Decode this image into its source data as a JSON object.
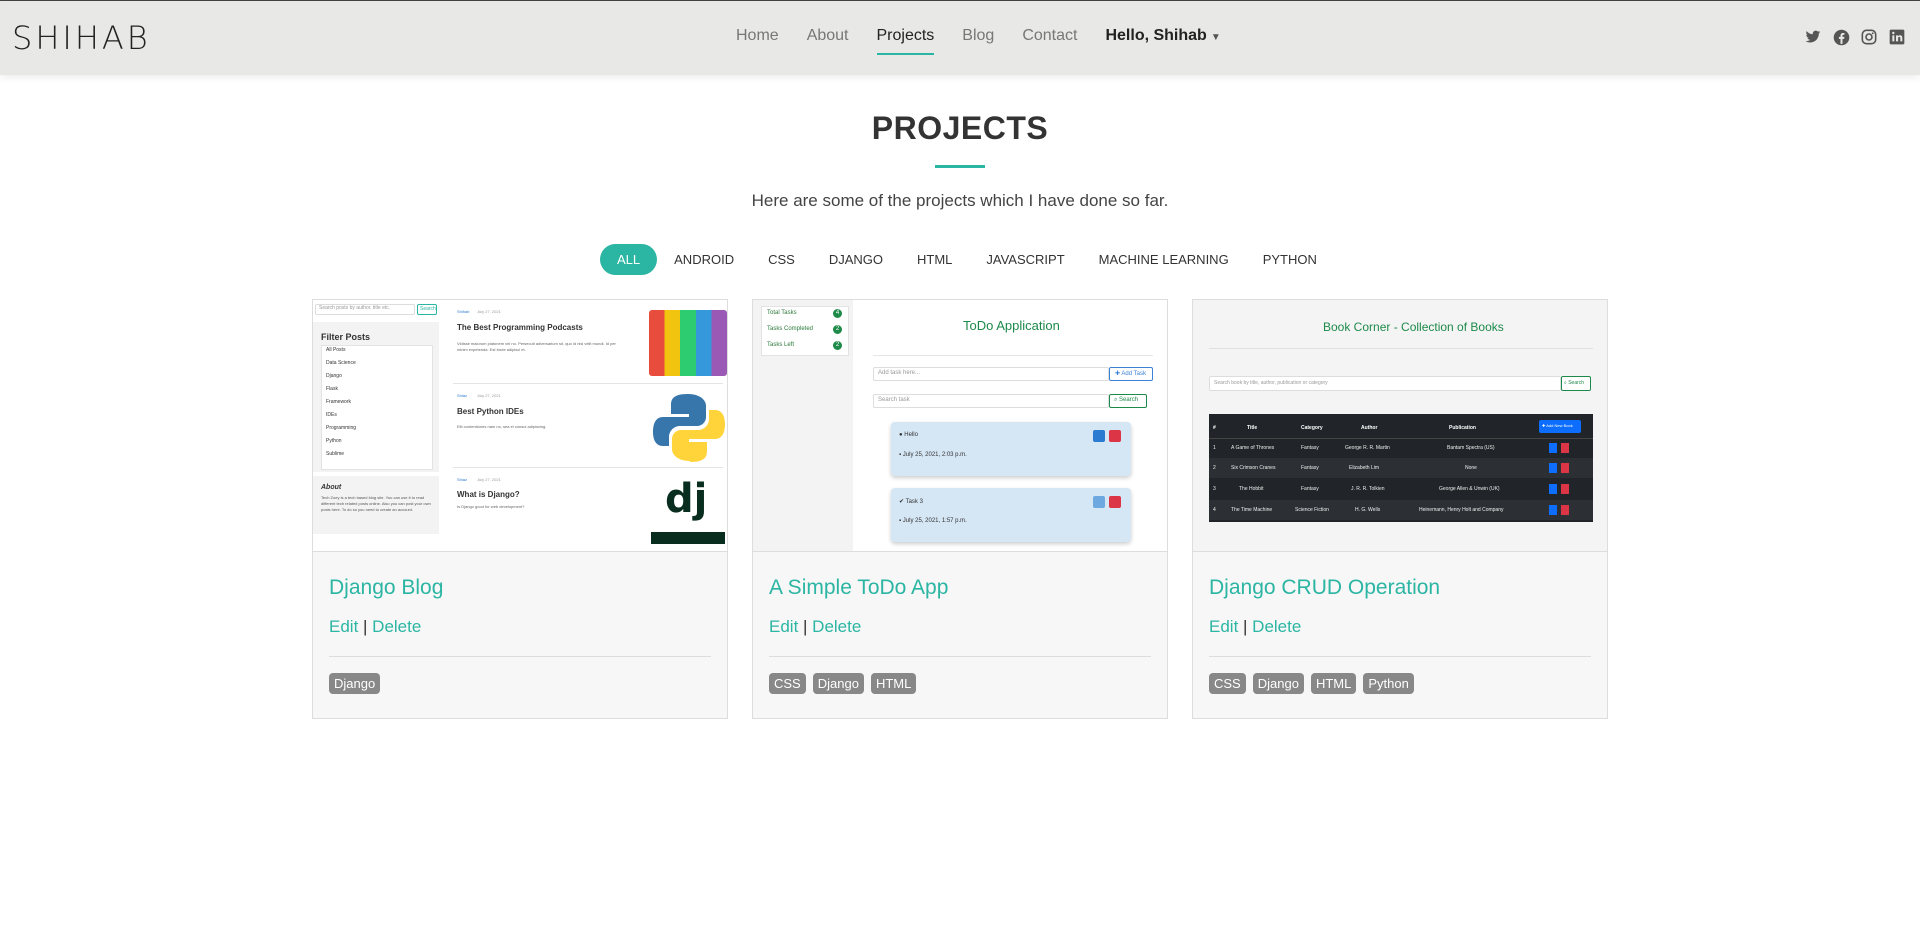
{
  "brand": "SHIHAB",
  "nav": {
    "home": "Home",
    "about": "About",
    "projects": "Projects",
    "blog": "Blog",
    "contact": "Contact",
    "user": "Hello, Shihab"
  },
  "social": [
    "twitter-icon",
    "facebook-icon",
    "instagram-icon",
    "linkedin-icon"
  ],
  "section": {
    "title": "PROJECTS",
    "subtitle": "Here are some of the projects which I have done so far."
  },
  "filters": [
    "ALL",
    "ANDROID",
    "CSS",
    "DJANGO",
    "HTML",
    "JAVASCRIPT",
    "MACHINE LEARNING",
    "PYTHON"
  ],
  "active_filter": "ALL",
  "accent_color": "#2bb5a3",
  "projects": [
    {
      "title": "Django Blog",
      "edit": "Edit",
      "separator": "|",
      "delete": "Delete",
      "tags": [
        "Django"
      ],
      "screenshot": {
        "search_placeholder": "Search posts by author, title etc.",
        "search_button": "Search",
        "filter_heading": "Filter Posts",
        "filters": [
          "All Posts",
          "Data Science",
          "Django",
          "Flask",
          "Framework",
          "IDEs",
          "Programming",
          "Python",
          "Sublime"
        ],
        "about_heading": "About",
        "about_text": "Tech Zoey is a tech based blog site. You can use it to read different tech related posts online. Also you can post your own posts here. To do so you need to create an account.",
        "posts": [
          {
            "author": "Shihab",
            "date": "July 27, 2021",
            "title": "The Best Programming Podcasts",
            "excerpt": "Vidisse maiorum platonem vel no. Persecuti adversarium sit, quo id nisl velit mundi. Id per minim expetenda. Est brute adipisci et."
          },
          {
            "author": "Shiaz",
            "date": "July 27, 2021",
            "title": "Best Python IDEs",
            "excerpt": "Elit contentiones nam no, sea ei consul adipiscing."
          },
          {
            "author": "Shiaz",
            "date": "July 27, 2021",
            "title": "What is Django?",
            "excerpt": "Is Django good for web development?"
          }
        ]
      }
    },
    {
      "title": "A Simple ToDo App",
      "edit": "Edit",
      "separator": "|",
      "delete": "Delete",
      "tags": [
        "CSS",
        "Django",
        "HTML"
      ],
      "screenshot": {
        "stats": [
          {
            "label": "Total Tasks",
            "count": "4"
          },
          {
            "label": "Tasks Completed",
            "count": "2"
          },
          {
            "label": "Tasks Left",
            "count": "2"
          }
        ],
        "heading": "ToDo Application",
        "add_placeholder": "Add task here...",
        "add_button": "Add Task",
        "search_placeholder": "Search task",
        "search_button": "Search",
        "tasks": [
          {
            "name": "Hello",
            "date": "July 25, 2021, 2:03 p.m."
          },
          {
            "name": "Task 3",
            "date": "July 25, 2021, 1:57 p.m."
          }
        ]
      }
    },
    {
      "title": "Django CRUD Operation",
      "edit": "Edit",
      "separator": "|",
      "delete": "Delete",
      "tags": [
        "CSS",
        "Django",
        "HTML",
        "Python"
      ],
      "screenshot": {
        "heading": "Book Corner - Collection of Books",
        "search_placeholder": "Search book by title, author, publication or category",
        "search_button": "Search",
        "add_button": "Add New Book",
        "columns": [
          "#",
          "Title",
          "Category",
          "Author",
          "Publication"
        ],
        "rows": [
          [
            "1",
            "A Game of Thrones",
            "Fantasy",
            "George R. R. Martin",
            "Bantam Spectra (US)"
          ],
          [
            "2",
            "Six Crimson Cranes",
            "Fantasy",
            "Elizabeth Lim",
            "None"
          ],
          [
            "3",
            "The Hobbit",
            "Fantasy",
            "J. R. R. Tolkien",
            "George Allen & Unwin (UK)"
          ],
          [
            "4",
            "The Time Machine",
            "Science Fiction",
            "H. G. Wells",
            "Heinemann, Henry Holt and Company"
          ]
        ]
      }
    }
  ]
}
